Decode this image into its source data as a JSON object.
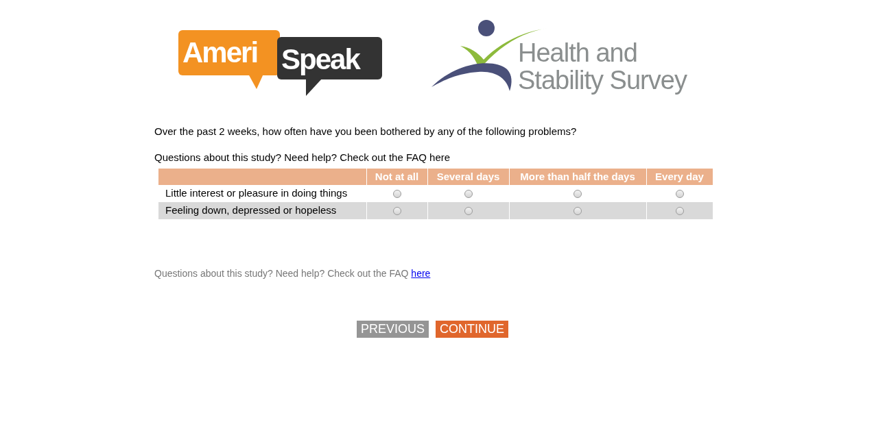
{
  "logos": {
    "amerispeak": {
      "part_1": "Ameri",
      "part_2": "Speak"
    },
    "survey": {
      "line_1": "Health and",
      "line_2": "Stability Survey"
    }
  },
  "question": "Over the past 2 weeks, how often have you been bothered by any of the following problems?",
  "help_line": "Questions about this study? Need help? Check out the FAQ here",
  "table": {
    "columns": [
      "Not at all",
      "Several days",
      "More than half the days",
      "Every day"
    ],
    "rows": [
      {
        "label": "Little interest or pleasure in doing things",
        "options": [
          {
            "selected": false
          },
          {
            "selected": false
          },
          {
            "selected": false
          },
          {
            "selected": false
          }
        ]
      },
      {
        "label": "Feeling down, depressed or hopeless",
        "options": [
          {
            "selected": false
          },
          {
            "selected": false
          },
          {
            "selected": false
          },
          {
            "selected": false
          }
        ]
      }
    ]
  },
  "footer": {
    "text": "Questions about this study? Need help? Check out the FAQ",
    "link": "here"
  },
  "buttons": [
    {
      "label": "PREVIOUS",
      "kind": "secondary"
    },
    {
      "label": "CONTINUE",
      "kind": "primary"
    }
  ]
}
